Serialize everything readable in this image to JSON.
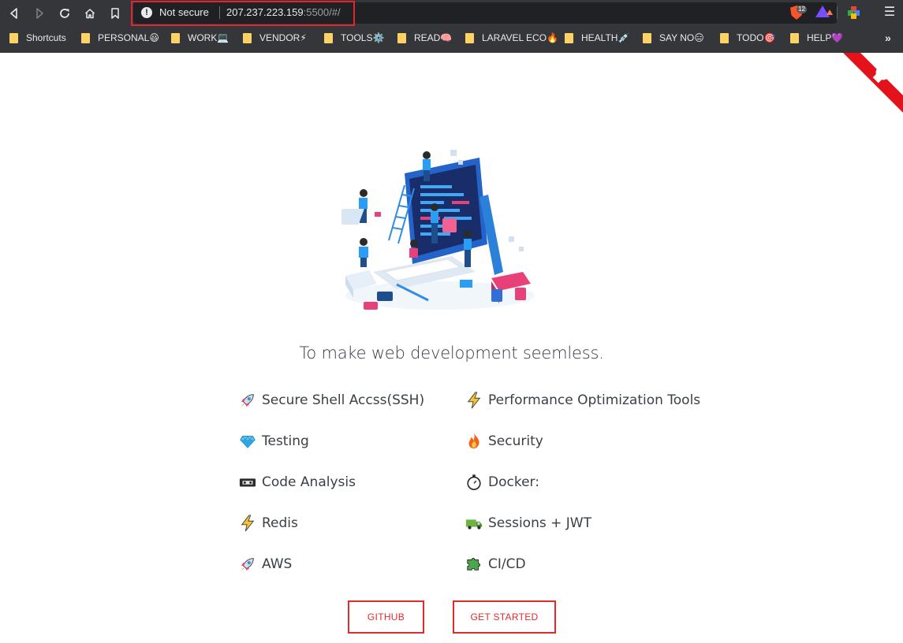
{
  "browser": {
    "nav": {
      "back_icon": "back-arrow-icon",
      "forward_icon": "forward-arrow-icon",
      "reload_icon": "reload-icon",
      "home_icon": "home-icon",
      "bookmark_icon": "bookmark-icon"
    },
    "omnibox": {
      "security_label": "Not secure",
      "url_host": "207.237.223.159",
      "url_rest": ":5500/#/",
      "highlight_color": "#e3262e"
    },
    "extensions": {
      "brave_badge": "12"
    },
    "bookmarks": [
      {
        "label": "Shortcuts"
      },
      {
        "label": "PERSONAL😃"
      },
      {
        "label": "WORK💻"
      },
      {
        "label": "VENDOR⚡"
      },
      {
        "label": "TOOLS⚙️"
      },
      {
        "label": "READ🧠"
      },
      {
        "label": "LARAVEL ECO🔥"
      },
      {
        "label": "HEALTH💉"
      },
      {
        "label": "SAY NO😑"
      },
      {
        "label": "TODO🎯"
      },
      {
        "label": "HELP💜"
      }
    ],
    "bookmarks_overflow": "»"
  },
  "page": {
    "accent_color": "#e02b2b",
    "tagline": "To make web development seemless.",
    "features_left": [
      {
        "icon": "rocket-icon",
        "label": "Secure Shell Accss(SSH)"
      },
      {
        "icon": "gem-icon",
        "label": "Testing"
      },
      {
        "icon": "vhs-tape-icon",
        "label": "Code Analysis"
      },
      {
        "icon": "lightning-icon",
        "label": "Redis"
      },
      {
        "icon": "rocket-icon",
        "label": "AWS"
      }
    ],
    "features_right": [
      {
        "icon": "lightning-icon",
        "label": "Performance Optimization Tools"
      },
      {
        "icon": "fire-icon",
        "label": "Security"
      },
      {
        "icon": "stopwatch-icon",
        "label": "Docker:"
      },
      {
        "icon": "truck-icon",
        "label": "Sessions + JWT"
      },
      {
        "icon": "puzzle-icon",
        "label": "CI/CD"
      }
    ],
    "buttons": {
      "github": "GITHUB",
      "get_started": "GET STARTED"
    }
  }
}
